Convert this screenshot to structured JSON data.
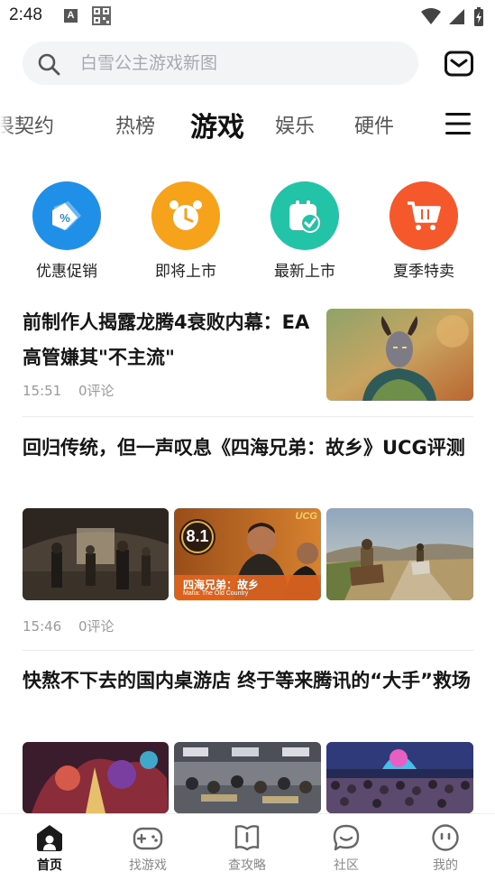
{
  "status_bar": {
    "time": "2:48",
    "indicator_a": "A"
  },
  "search": {
    "placeholder": "白雪公主游戏新图"
  },
  "tabs": [
    {
      "label": "畏契约"
    },
    {
      "label": "热榜"
    },
    {
      "label": "游戏"
    },
    {
      "label": "娱乐"
    },
    {
      "label": "硬件"
    }
  ],
  "active_tab": "游戏",
  "shortcuts": [
    {
      "label": "优惠促销",
      "icon": "discount-tag-icon",
      "color": "#1f8fe8"
    },
    {
      "label": "即将上市",
      "icon": "alarm-clock-icon",
      "color": "#f7a21b"
    },
    {
      "label": "最新上市",
      "icon": "calendar-check-icon",
      "color": "#22c3a6"
    },
    {
      "label": "夏季特卖",
      "icon": "shopping-cart-icon",
      "color": "#f4582b"
    }
  ],
  "articles": [
    {
      "title": "前制作人揭露龙腾4衰败内幕：EA高管嫌其\"不主流\"",
      "time": "15:51",
      "comments": "0评论"
    },
    {
      "title": "回归传统，但一声叹息《四海兄弟：故乡》UCG评测",
      "time": "15:46",
      "comments": "0评论",
      "image_text": {
        "score": "8.1",
        "brand": "UCG",
        "game_cn": "四海兄弟：故乡",
        "game_en": "Mafia: The Old Country"
      }
    },
    {
      "title": "快熬不下去的国内桌游店 终于等来腾讯的“大手”救场"
    }
  ],
  "bottom_nav": [
    {
      "label": "首页",
      "icon": "home-icon",
      "active": true
    },
    {
      "label": "找游戏",
      "icon": "gamepad-icon",
      "active": false
    },
    {
      "label": "查攻略",
      "icon": "guide-book-icon",
      "active": false
    },
    {
      "label": "社区",
      "icon": "community-chat-icon",
      "active": false
    },
    {
      "label": "我的",
      "icon": "profile-icon",
      "active": false
    }
  ]
}
